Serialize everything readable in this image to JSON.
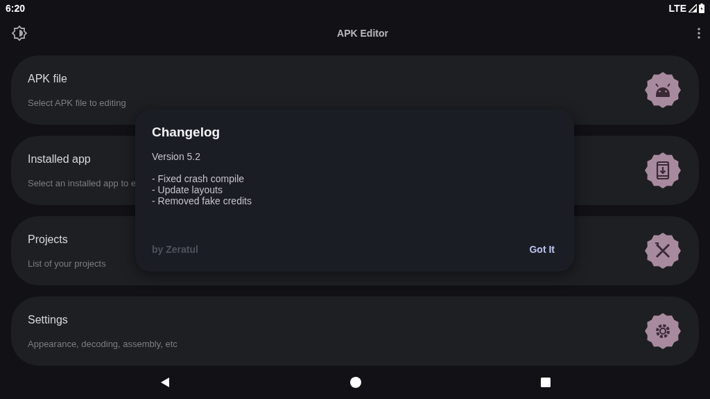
{
  "status_bar": {
    "time": "6:20",
    "network": "LTE"
  },
  "app_bar": {
    "title": "APK Editor"
  },
  "cards": [
    {
      "kind": "android",
      "title": "APK file",
      "subtitle": "Select APK file to editing"
    },
    {
      "kind": "phone-download",
      "title": "Installed app",
      "subtitle": "Select an installed app to e"
    },
    {
      "kind": "tools",
      "title": "Projects",
      "subtitle": "List of your projects"
    },
    {
      "kind": "gear",
      "title": "Settings",
      "subtitle": "Appearance, decoding, assembly, etc"
    }
  ],
  "dialog": {
    "title": "Changelog",
    "version": "Version 5.2",
    "lines": [
      "- Fixed crash compile",
      "- Update layouts",
      "- Removed fake credits"
    ],
    "author": "by Zeratul",
    "button": "Got It"
  }
}
